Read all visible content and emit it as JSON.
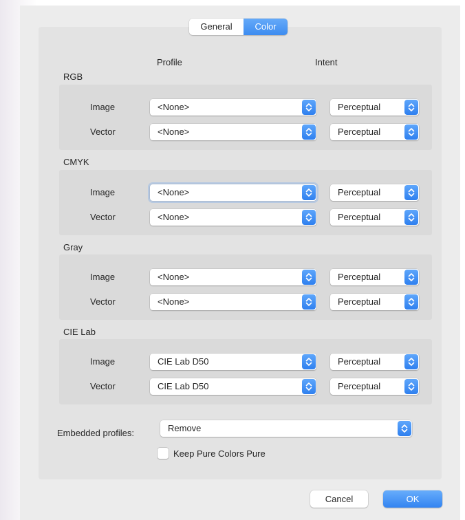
{
  "tabs": [
    {
      "label": "General",
      "selected": false
    },
    {
      "label": "Color",
      "selected": true
    }
  ],
  "columns": {
    "profile": "Profile",
    "intent": "Intent"
  },
  "sections": [
    {
      "title": "RGB",
      "rows": [
        {
          "label": "Image",
          "profile": "<None>",
          "intent": "Perceptual"
        },
        {
          "label": "Vector",
          "profile": "<None>",
          "intent": "Perceptual"
        }
      ]
    },
    {
      "title": "CMYK",
      "rows": [
        {
          "label": "Image",
          "profile": "<None>",
          "intent": "Perceptual"
        },
        {
          "label": "Vector",
          "profile": "<None>",
          "intent": "Perceptual"
        }
      ]
    },
    {
      "title": "Gray",
      "rows": [
        {
          "label": "Image",
          "profile": "<None>",
          "intent": "Perceptual"
        },
        {
          "label": "Vector",
          "profile": "<None>",
          "intent": "Perceptual"
        }
      ]
    },
    {
      "title": "CIE Lab",
      "rows": [
        {
          "label": "Image",
          "profile": "CIE Lab D50",
          "intent": "Perceptual"
        },
        {
          "label": "Vector",
          "profile": "CIE Lab D50",
          "intent": "Perceptual"
        }
      ]
    }
  ],
  "embedded": {
    "label": "Embedded profiles:",
    "value": "Remove"
  },
  "keep_pure": {
    "label": "Keep Pure Colors Pure",
    "checked": false
  },
  "buttons": {
    "cancel": "Cancel",
    "ok": "OK"
  },
  "colors": {
    "accent": "#3d8cf0",
    "panel": "#e3e3e3",
    "group": "#dadada",
    "window": "#ececec"
  },
  "icons": {
    "popup_arrows": "chevron-up-down-icon"
  }
}
